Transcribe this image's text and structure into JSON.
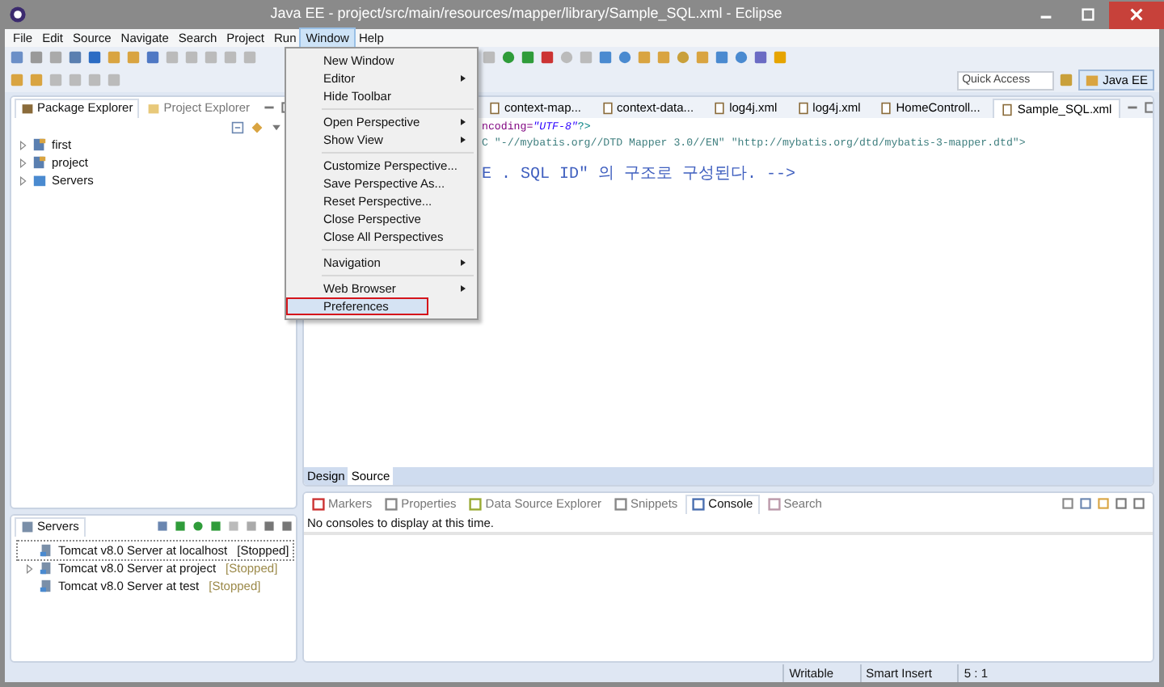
{
  "window": {
    "title": "Java EE - project/src/main/resources/mapper/library/Sample_SQL.xml - Eclipse"
  },
  "menu_bar": [
    {
      "label": "File",
      "selected": false
    },
    {
      "label": "Edit",
      "selected": false
    },
    {
      "label": "Source",
      "selected": false
    },
    {
      "label": "Navigate",
      "selected": false
    },
    {
      "label": "Search",
      "selected": false
    },
    {
      "label": "Project",
      "selected": false
    },
    {
      "label": "Run",
      "selected": false
    },
    {
      "label": "Window",
      "selected": true
    },
    {
      "label": "Help",
      "selected": false
    }
  ],
  "window_menu": {
    "groups": [
      [
        {
          "label": "New Window",
          "submenu": false,
          "highlighted": false
        },
        {
          "label": "Editor",
          "submenu": true,
          "highlighted": false
        },
        {
          "label": "Hide Toolbar",
          "submenu": false,
          "highlighted": false
        }
      ],
      [
        {
          "label": "Open Perspective",
          "submenu": true,
          "highlighted": false
        },
        {
          "label": "Show View",
          "submenu": true,
          "highlighted": false
        }
      ],
      [
        {
          "label": "Customize Perspective...",
          "submenu": false,
          "highlighted": false
        },
        {
          "label": "Save Perspective As...",
          "submenu": false,
          "highlighted": false
        },
        {
          "label": "Reset Perspective...",
          "submenu": false,
          "highlighted": false
        },
        {
          "label": "Close Perspective",
          "submenu": false,
          "highlighted": false
        },
        {
          "label": "Close All Perspectives",
          "submenu": false,
          "highlighted": false
        }
      ],
      [
        {
          "label": "Navigation",
          "submenu": true,
          "highlighted": false
        }
      ],
      [
        {
          "label": "Web Browser",
          "submenu": true,
          "highlighted": false
        },
        {
          "label": "Preferences",
          "submenu": false,
          "highlighted": true
        }
      ]
    ]
  },
  "quick_access": {
    "placeholder": "Quick Access"
  },
  "perspective": {
    "label": "Java EE",
    "selected": true
  },
  "package_explorer": {
    "tabs": [
      {
        "label": "Package Explorer",
        "selected": true
      },
      {
        "label": "Project Explorer",
        "selected": false
      }
    ],
    "items": [
      {
        "label": "first",
        "expanded": false
      },
      {
        "label": "project",
        "expanded": false
      },
      {
        "label": "Servers",
        "expanded": false
      }
    ]
  },
  "editor": {
    "tabs": [
      {
        "label": "context-map...",
        "selected": false
      },
      {
        "label": "context-data...",
        "selected": false
      },
      {
        "label": "log4j.xml",
        "selected": false
      },
      {
        "label": "log4j.xml",
        "selected": false
      },
      {
        "label": "HomeControll...",
        "selected": false
      },
      {
        "label": "Sample_SQL.xml",
        "selected": true
      }
    ],
    "lines": [
      [
        {
          "kind": "attr",
          "text": "ncoding="
        },
        {
          "kind": "value",
          "text": "\"UTF-8\""
        },
        {
          "kind": "tag",
          "text": "?>"
        }
      ],
      [
        {
          "kind": "doctype",
          "text": "C \"-//mybatis.org//DTD Mapper 3.0//EN\" \"http://mybatis.org/dtd/mybatis-3-mapper.dtd\">"
        }
      ],
      [
        {
          "kind": "comment",
          "text": "E . SQL ID\" 의 구조로 구성된다. -->"
        }
      ]
    ],
    "bottom_tabs": [
      {
        "label": "Design",
        "selected": false
      },
      {
        "label": "Source",
        "selected": true
      }
    ]
  },
  "servers": {
    "title": "Servers",
    "items": [
      {
        "name": "Tomcat v8.0 Server at localhost",
        "status": "[Stopped]",
        "kind": "leaf",
        "selected": true
      },
      {
        "name": "Tomcat v8.0 Server at project",
        "status": "[Stopped]",
        "kind": "node",
        "selected": false
      },
      {
        "name": "Tomcat v8.0 Server at test",
        "status": "[Stopped]",
        "kind": "leaf",
        "selected": false
      }
    ]
  },
  "console": {
    "tabs": [
      {
        "label": "Markers",
        "selected": false
      },
      {
        "label": "Properties",
        "selected": false
      },
      {
        "label": "Data Source Explorer",
        "selected": false
      },
      {
        "label": "Snippets",
        "selected": false
      },
      {
        "label": "Console",
        "selected": true
      },
      {
        "label": "Search",
        "selected": false
      }
    ],
    "message": "No consoles to display at this time."
  },
  "status_bar": [
    "Writable",
    "Smart Insert",
    "5 : 1"
  ]
}
